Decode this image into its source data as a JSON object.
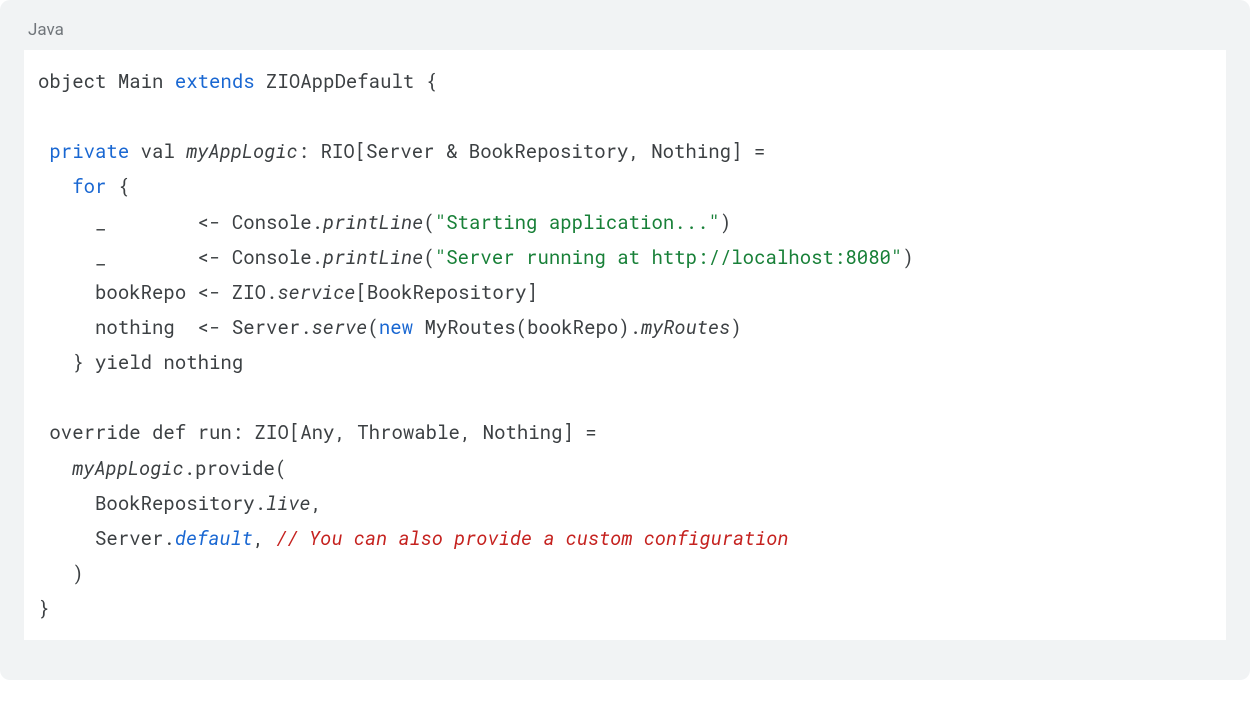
{
  "code_block": {
    "language_label": "Java",
    "lines": [
      [
        {
          "t": "object Main ",
          "c": ""
        },
        {
          "t": "extends",
          "c": "kw"
        },
        {
          "t": " ZIOAppDefault {",
          "c": ""
        }
      ],
      [],
      [
        {
          "t": " ",
          "c": ""
        },
        {
          "t": "private",
          "c": "kw"
        },
        {
          "t": " val ",
          "c": ""
        },
        {
          "t": "myAppLogic",
          "c": "it"
        },
        {
          "t": ": RIO[Server & BookRepository, Nothing] =",
          "c": ""
        }
      ],
      [
        {
          "t": "   ",
          "c": ""
        },
        {
          "t": "for",
          "c": "kw"
        },
        {
          "t": " {",
          "c": ""
        }
      ],
      [
        {
          "t": "     _        <- Console.",
          "c": ""
        },
        {
          "t": "printLine",
          "c": "it"
        },
        {
          "t": "(",
          "c": ""
        },
        {
          "t": "\"Starting application...\"",
          "c": "str"
        },
        {
          "t": ")",
          "c": ""
        }
      ],
      [
        {
          "t": "     _        <- Console.",
          "c": ""
        },
        {
          "t": "printLine",
          "c": "it"
        },
        {
          "t": "(",
          "c": ""
        },
        {
          "t": "\"Server running at http://localhost:8080\"",
          "c": "str"
        },
        {
          "t": ")",
          "c": ""
        }
      ],
      [
        {
          "t": "     bookRepo <- ZIO.",
          "c": ""
        },
        {
          "t": "service",
          "c": "it"
        },
        {
          "t": "[BookRepository]",
          "c": ""
        }
      ],
      [
        {
          "t": "     nothing  <- Server.",
          "c": ""
        },
        {
          "t": "serve",
          "c": "it"
        },
        {
          "t": "(",
          "c": ""
        },
        {
          "t": "new",
          "c": "kw"
        },
        {
          "t": " MyRoutes(bookRepo).",
          "c": ""
        },
        {
          "t": "myRoutes",
          "c": "it"
        },
        {
          "t": ")",
          "c": ""
        }
      ],
      [
        {
          "t": "   } yield nothing",
          "c": ""
        }
      ],
      [],
      [
        {
          "t": " override def run: ZIO[Any, Throwable, Nothing] =",
          "c": ""
        }
      ],
      [
        {
          "t": "   ",
          "c": ""
        },
        {
          "t": "myAppLogic",
          "c": "it"
        },
        {
          "t": ".provide(",
          "c": ""
        }
      ],
      [
        {
          "t": "     BookRepository.",
          "c": ""
        },
        {
          "t": "live",
          "c": "it"
        },
        {
          "t": ",",
          "c": ""
        }
      ],
      [
        {
          "t": "     Server.",
          "c": ""
        },
        {
          "t": "default",
          "c": "kw it"
        },
        {
          "t": ", ",
          "c": ""
        },
        {
          "t": "// You can also provide a custom configuration",
          "c": "com"
        }
      ],
      [
        {
          "t": "   )",
          "c": ""
        }
      ],
      [
        {
          "t": "}",
          "c": ""
        }
      ]
    ]
  }
}
